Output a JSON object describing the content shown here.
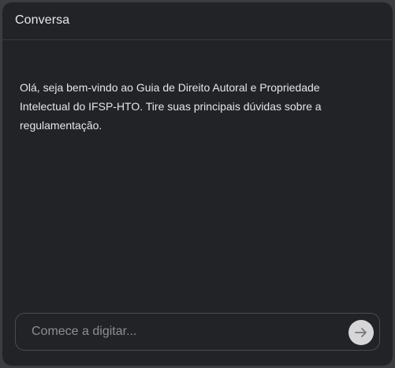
{
  "header": {
    "title": "Conversa"
  },
  "messages": [
    {
      "text": "Olá, seja bem-vindo ao Guia de Direito Autoral e Propriedade Intelectual do IFSP-HTO. Tire suas principais dúvidas sobre a regulamentação."
    }
  ],
  "composer": {
    "placeholder": "Comece a digitar...",
    "value": "",
    "send_icon": "arrow-right-icon"
  },
  "colors": {
    "background": "#222327",
    "outer": "#3c3d41",
    "text": "#e6e6e8",
    "placeholder": "#8d8e93",
    "send_button": "#d6d6d8"
  }
}
